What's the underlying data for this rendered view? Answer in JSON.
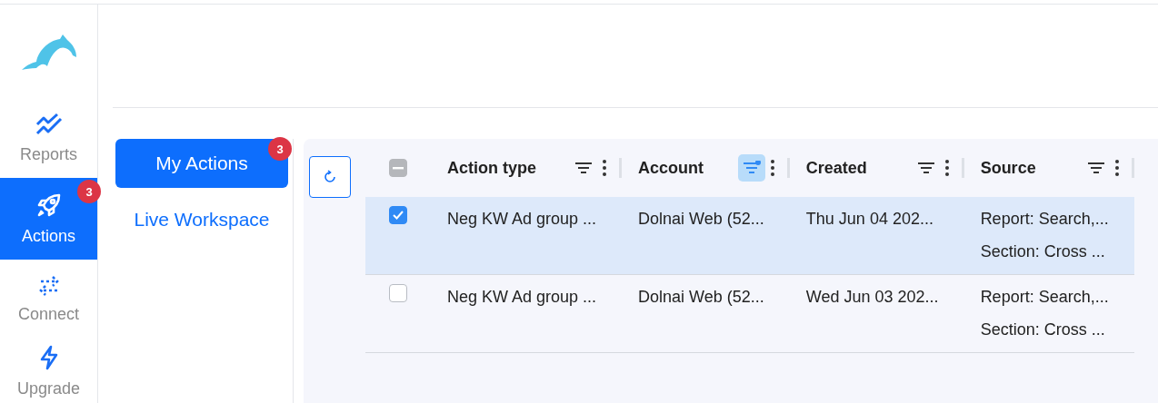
{
  "nav": [
    {
      "label": "Reports",
      "selected": false
    },
    {
      "label": "Actions",
      "selected": true,
      "badge": "3"
    },
    {
      "label": "Connect",
      "selected": false
    },
    {
      "label": "Upgrade",
      "selected": false
    }
  ],
  "subnav": [
    {
      "label": "My Actions",
      "selected": true,
      "badge": "3"
    },
    {
      "label": "Live Workspace",
      "selected": false
    }
  ],
  "table": {
    "select_all": {
      "indeterminate": true
    },
    "columns": [
      {
        "label": "Action type",
        "filter_active": false
      },
      {
        "label": "Account",
        "filter_active": true
      },
      {
        "label": "Created",
        "filter_active": false
      },
      {
        "label": "Source",
        "filter_active": false
      }
    ],
    "rows": [
      {
        "selected": true,
        "cells": [
          "Neg KW Ad group ...",
          "Dolnai Web (52...",
          "Thu Jun 04 202...",
          [
            "Report: Search,...",
            "Section: Cross ..."
          ]
        ]
      },
      {
        "selected": false,
        "cells": [
          "Neg KW Ad group ...",
          "Dolnai Web (52...",
          "Wed Jun 03 202...",
          [
            "Report: Search,...",
            "Section: Cross ..."
          ]
        ]
      }
    ]
  }
}
